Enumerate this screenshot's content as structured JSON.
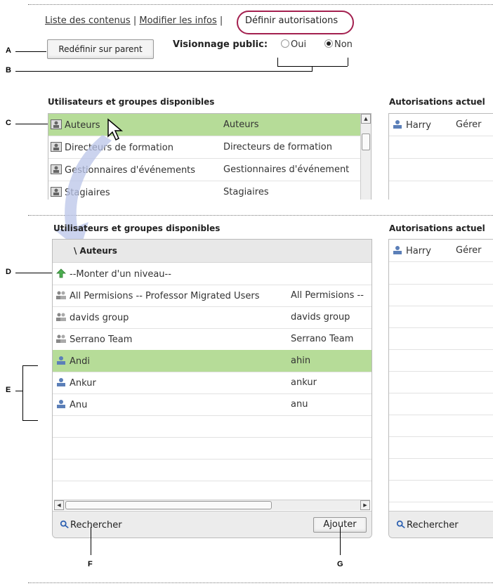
{
  "nav": {
    "link_contents": "Liste des contenus",
    "sep1": "|",
    "link_edit": "Modifier les infos",
    "sep2": "|",
    "link_permissions": "Définir autorisations"
  },
  "reset_button": "Redéfinir sur parent",
  "public_view": {
    "label": "Visionnage public:",
    "option_yes": "Oui",
    "option_no": "Non",
    "selected": "Non"
  },
  "callouts": [
    "A",
    "B",
    "C",
    "D",
    "E",
    "F",
    "G"
  ],
  "top_section": {
    "available_title": "Utilisateurs et groupes disponibles",
    "current_title": "Autorisations actuel",
    "rows": [
      {
        "name": "Auteurs",
        "desc": "Auteurs",
        "selected": true
      },
      {
        "name": "Directeurs de formation",
        "desc": "Directeurs de formation",
        "selected": false
      },
      {
        "name": "Gestionnaires d'événements",
        "desc": "Gestionnaires d'événement",
        "selected": false
      },
      {
        "name": "Stagiaires",
        "desc": "Stagiaires",
        "selected": false
      }
    ],
    "current": [
      {
        "user": "Harry",
        "perm": "Gérer"
      }
    ]
  },
  "bottom_section": {
    "available_title": "Utilisateurs et groupes disponibles",
    "current_title": "Autorisations actuel",
    "path": "\\ Auteurs",
    "up_level": "--Monter d'un niveau--",
    "rows": [
      {
        "type": "group",
        "name": "All Permisions -- Professor Migrated Users",
        "desc": "All Permisions --"
      },
      {
        "type": "group",
        "name": "davids group",
        "desc": "davids group"
      },
      {
        "type": "group",
        "name": "Serrano Team",
        "desc": "Serrano Team"
      },
      {
        "type": "user",
        "name": "Andi",
        "desc": "ahin",
        "selected": true
      },
      {
        "type": "user",
        "name": "Ankur",
        "desc": "ankur"
      },
      {
        "type": "user",
        "name": "Anu",
        "desc": "anu"
      }
    ],
    "current": [
      {
        "user": "Harry",
        "perm": "Gérer"
      }
    ],
    "search_label": "Rechercher",
    "add_button": "Ajouter",
    "search_label_right": "Rechercher"
  },
  "colors": {
    "selected_row": "#b6dc98",
    "highlight_ring": "#a3204f",
    "panel_footer": "#ececec"
  }
}
